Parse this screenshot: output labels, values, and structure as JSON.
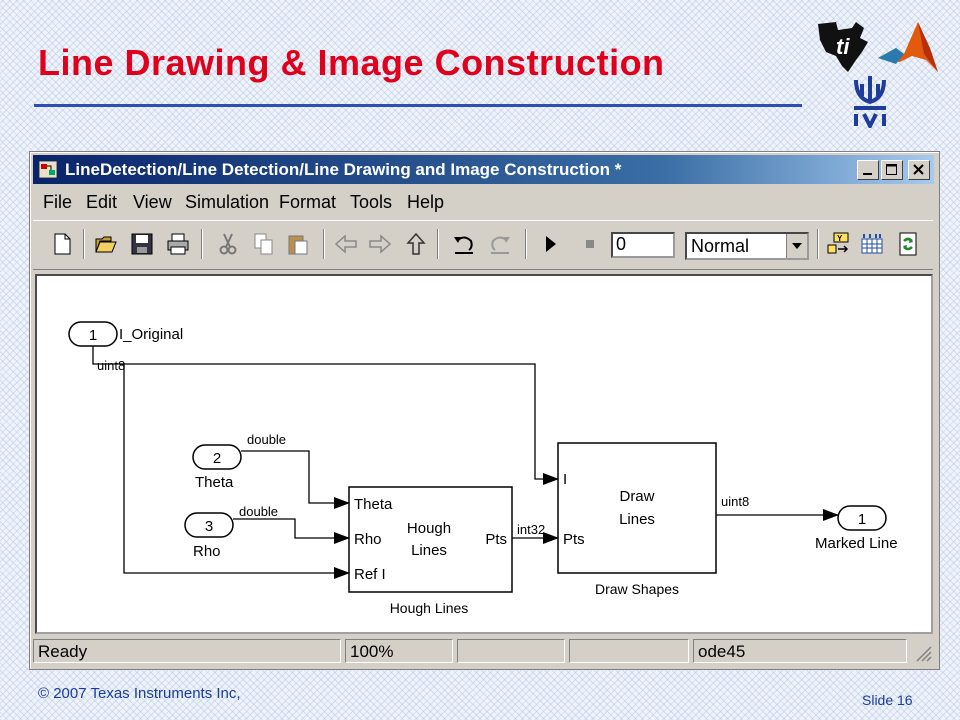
{
  "slide": {
    "title": "Line Drawing & Image Construction",
    "footer_left": "© 2007 Texas Instruments Inc,",
    "footer_right": "Slide 16"
  },
  "window": {
    "title": "LineDetection/Line Detection/Line Drawing  and Image Construction *",
    "menu": [
      "File",
      "Edit",
      "View",
      "Simulation",
      "Format",
      "Tools",
      "Help"
    ],
    "stop_time": "0",
    "sim_mode": "Normal"
  },
  "model": {
    "inport_i": {
      "number": "1",
      "label": "I_Original",
      "signal": "uint8"
    },
    "inport_theta": {
      "number": "2",
      "label": "Theta",
      "signal": "double"
    },
    "inport_rho": {
      "number": "3",
      "label": "Rho",
      "signal": "double"
    },
    "hough": {
      "ports_in": [
        "Theta",
        "Rho",
        "Ref I"
      ],
      "port_out": "Pts",
      "name": [
        "Hough",
        "Lines"
      ],
      "caption": "Hough Lines",
      "out_signal": "int32"
    },
    "draw": {
      "ports_in": [
        "I",
        "Pts"
      ],
      "name": [
        "Draw",
        "Lines"
      ],
      "caption": "Draw Shapes",
      "out_signal": "uint8"
    },
    "outport": {
      "number": "1",
      "label": "Marked Line"
    }
  },
  "status": {
    "state": "Ready",
    "zoom": "100%",
    "solver": "ode45"
  },
  "colors": {
    "title_red": "#e0001b",
    "rule_blue": "#2e4fb0",
    "titlebar_dark": "#0a246a",
    "footer_blue": "#1a3c9a"
  },
  "icons": [
    "ti-logo-icon",
    "matlab-logo-icon",
    "university-emblem-icon",
    "new-icon",
    "open-icon",
    "save-icon",
    "print-icon",
    "cut-icon",
    "copy-icon",
    "paste-icon",
    "back-icon",
    "forward-icon",
    "up-icon",
    "undo-icon",
    "redo-icon",
    "play-icon",
    "stop-icon",
    "model-browser-icon",
    "library-icon",
    "refresh-icon"
  ]
}
